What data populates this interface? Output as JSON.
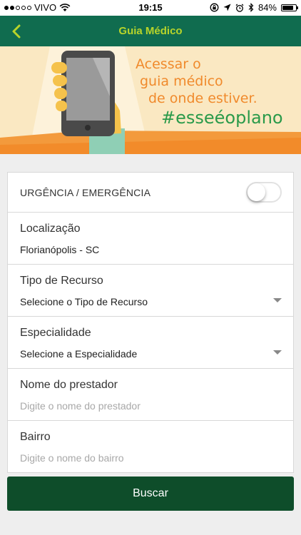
{
  "status_bar": {
    "carrier": "VIVO",
    "time": "19:15",
    "battery_percent": "84%",
    "battery_level": 0.84,
    "signal_bars_filled": 2,
    "icons": [
      "wifi-icon",
      "rotation-lock-icon",
      "location-arrow-icon",
      "alarm-icon",
      "bluetooth-icon",
      "battery-icon"
    ]
  },
  "navbar": {
    "title": "Guia Médico",
    "back_icon": "chevron-left-icon",
    "bg_color": "#106c4f",
    "title_color": "#b8d42a"
  },
  "banner": {
    "line1": "Acessar o",
    "line2": "guia médico",
    "line3": "de onde estiver.",
    "hashtag": "#esseéoplano"
  },
  "form": {
    "urgencia_label": "URGÊNCIA / EMERGÊNCIA",
    "urgencia_on": false,
    "localizacao": {
      "label": "Localização",
      "value": "Florianópolis - SC"
    },
    "tipo_recurso": {
      "label": "Tipo de Recurso",
      "value": "Selecione o Tipo de Recurso"
    },
    "especialidade": {
      "label": "Especialidade",
      "value": "Selecione a Especialidade"
    },
    "nome_prestador": {
      "label": "Nome do prestador",
      "placeholder": "Digite o nome do prestador"
    },
    "bairro": {
      "label": "Bairro",
      "placeholder": "Digite o nome do bairro"
    }
  },
  "actions": {
    "search_label": "Buscar",
    "button_color": "#0e4d2a"
  }
}
